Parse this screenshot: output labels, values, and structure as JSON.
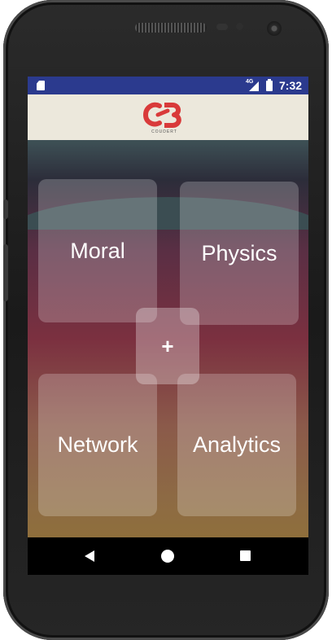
{
  "status_bar": {
    "network": "4G",
    "time": "7:32"
  },
  "header": {
    "logo_icon": "cb-logo-icon",
    "logo_text": "COUDERT"
  },
  "tiles": {
    "moral": "Moral",
    "physics": "Physics",
    "network": "Network",
    "analytics": "Analytics",
    "add": "+"
  },
  "nav": {
    "back_icon": "back-triangle-icon",
    "home_icon": "home-circle-icon",
    "recents_icon": "recents-square-icon"
  },
  "colors": {
    "status_bar": "#2b3a8e",
    "header_bg": "#ece8dc",
    "logo_red": "#d93a3a"
  }
}
